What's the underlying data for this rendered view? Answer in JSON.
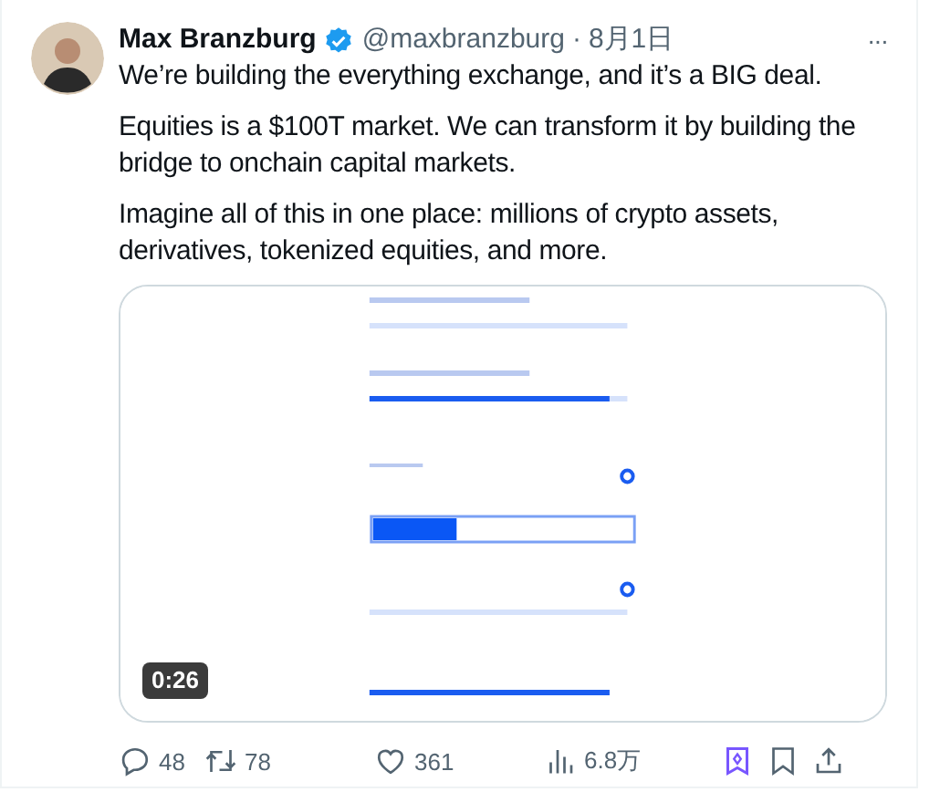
{
  "author": {
    "name": "Max Branzburg",
    "verified": true,
    "handle": "@maxbranzburg",
    "separator": "·",
    "date": "8月1日"
  },
  "more_menu": "···",
  "body": [
    "We’re building the everything exchange, and it’s a BIG deal.",
    "Equities is a $100T market. We can transform it by building the bridge to onchain capital markets.",
    "Imagine all of this in one place: millions of crypto assets, derivatives, tokenized equities, and more."
  ],
  "media": {
    "kind": "picture",
    "duration": "0:26"
  },
  "actions": [
    {
      "kind": "reply",
      "count": "48"
    },
    {
      "kind": "repost",
      "count": "78"
    },
    {
      "kind": "like",
      "count": "361"
    },
    {
      "kind": "views",
      "count": "6.8万"
    },
    {
      "kind": "grok"
    },
    {
      "kind": "bookmark"
    },
    {
      "kind": "share"
    }
  ]
}
